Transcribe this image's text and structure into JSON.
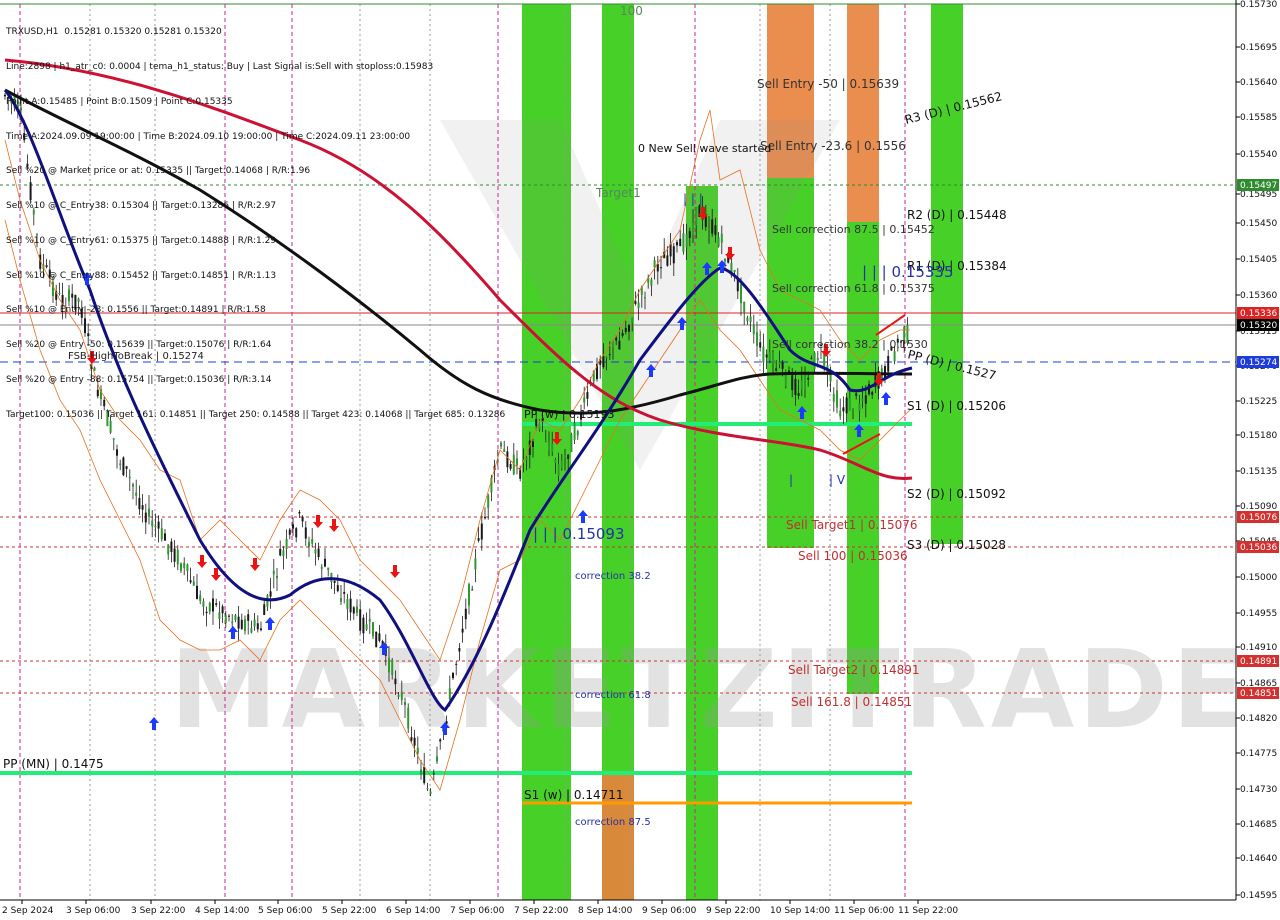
{
  "header": {
    "symbol_line": "TRXUSD,H1  0.15281 0.15320 0.15281 0.15320",
    "lines": [
      "Line:2898 | h1_atr_c0: 0.0004 | tema_h1_status: Buy | Last Signal is:Sell with stoploss:0.15983",
      "Point A:0.15485 | Point B:0.1509 | Point C:0.15335",
      "Time A:2024.09.09 19:00:00 | Time B:2024.09.10 19:00:00 | Time C:2024.09.11 23:00:00",
      "Sell %20 @ Market price or at: 0.15335 || Target:0.14068 | R/R:1.96",
      "Sell %10 @ C_Entry38: 0.15304 || Target:0.13286 | R/R:2.97",
      "Sell %10 @ C_Entry61: 0.15375 || Target:0.14888 | R/R:1.29",
      "Sell %10 @ C_Entry88: 0.15452 || Target:0.14851 | R/R:1.13",
      "Sell %10 @ Entry -23: 0.1556 || Target:0.14891 | R/R:1.58",
      "Sell %20 @ Entry -50: 0.15639 || Target:0.15076 | R/R:1.64",
      "Sell %20 @ Entry -88: 0.15754 || Target:0.15036 | R/R:3.14",
      "Target100: 0.15036 || Target 161: 0.14851 || Target 250: 0.14588 || Target 423: 0.14068 || Target 685: 0.13286"
    ]
  },
  "watermark": "MARKETZITRADE",
  "price_axis": {
    "ticks": [
      "0.15730",
      "0.15695",
      "0.15640",
      "0.15585",
      "0.15540",
      "0.15495",
      "0.15450",
      "0.15405",
      "0.15360",
      "0.15315",
      "0.15270",
      "0.15225",
      "0.15180",
      "0.15135",
      "0.15090",
      "0.15045",
      "0.15000",
      "0.14955",
      "0.14910",
      "0.14865",
      "0.14820",
      "0.14775",
      "0.14730",
      "0.14685",
      "0.14640",
      "0.14595"
    ],
    "badges": [
      {
        "label": "0.15497",
        "color": "#2e8b2e"
      },
      {
        "label": "0.15336",
        "color": "#dd2222"
      },
      {
        "label": "0.15320",
        "color": "#000000"
      },
      {
        "label": "0.15274",
        "color": "#1e3cdc"
      },
      {
        "label": "0.15076",
        "color": "#d43030"
      },
      {
        "label": "0.15036",
        "color": "#d43030"
      },
      {
        "label": "0.14891",
        "color": "#d43030"
      },
      {
        "label": "0.14851",
        "color": "#d43030"
      }
    ]
  },
  "time_axis": [
    "2 Sep 2024",
    "3 Sep 06:00",
    "3 Sep 22:00",
    "4 Sep 14:00",
    "5 Sep 06:00",
    "5 Sep 22:00",
    "6 Sep 14:00",
    "7 Sep 06:00",
    "7 Sep 22:00",
    "8 Sep 14:00",
    "9 Sep 06:00",
    "9 Sep 22:00",
    "10 Sep 14:00",
    "11 Sep 06:00",
    "11 Sep 22:00"
  ],
  "labels": {
    "fsb": "FSB-HighToBreak | 0.15274",
    "pp_w": "PP (w) | 0.15193",
    "pp_mn": "PP (MN) | 0.1475",
    "s1_w": "S1 (w) | 0.14711",
    "r3_d": "R3 (D) | 0.15562",
    "r2_d": "R2 (D) | 0.15448",
    "r1_d": "R1 (D) | 0.15384",
    "pp_d": "PP (D) | 0.1527",
    "s1_d": "S1 (D) | 0.15206",
    "s2_d": "S2 (D) | 0.15092",
    "s3_d": "S3 (D) | 0.15028",
    "sell_entry_50": "Sell Entry -50 | 0.15639",
    "sell_entry_236": "Sell Entry -23.6 | 0.1556",
    "new_sell_wave": "0 New Sell wave started",
    "target1": "Target1",
    "label_100": "100",
    "sell_corr_875": "Sell correction 87.5 | 0.15452",
    "sell_corr_618": "Sell correction 61.8 | 0.15375",
    "sell_corr_382": "Sell correction 38.2 | 0.1530",
    "point_c": "| | | 0.15335",
    "point_b": "| | | 0.15093",
    "sell_target1": "Sell Target1 | 0.15076",
    "sell_100": "Sell 100 | 0.15036",
    "sell_target2": "Sell Target2 | 0.14891",
    "sell_1618": "Sell 161.8 | 0.14851",
    "corr_382": "correction 38.2",
    "corr_618": "correction 61.8",
    "corr_875": "correction 87.5",
    "peak_marks": "| | |",
    "low_mark_1": "|",
    "low_mark_2": "| V"
  },
  "colors": {
    "green": "#33cc11",
    "orange": "#e8823c",
    "ema_black": "#111111",
    "ma_red": "#cc1133",
    "ma_blue": "#101080",
    "candle_dark": "#1a1a1a",
    "candle_green": "#2e9a2e",
    "sr_green": "#22ee77",
    "sr_orange": "#ff9900"
  }
}
